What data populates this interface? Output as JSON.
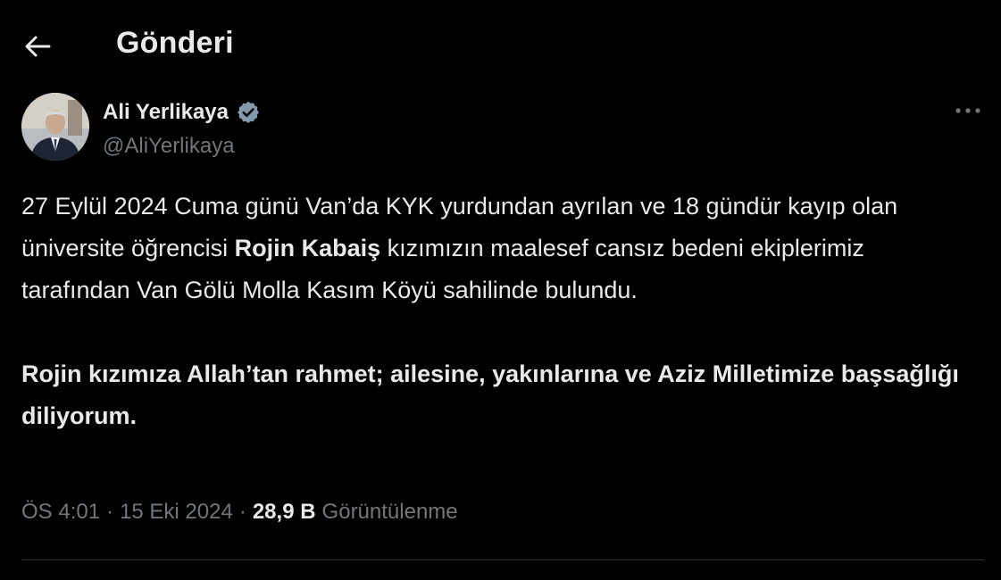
{
  "header": {
    "title": "Gönderi",
    "back_icon": "arrow-left-icon"
  },
  "author": {
    "name": "Ali Yerlikaya",
    "handle": "@AliYerlikaya",
    "verified_icon": "verified-badge-icon",
    "verified_color": "#829aab",
    "more_icon": "more-horizontal-icon"
  },
  "tweet": {
    "p1_part1": "27 Eylül 2024 Cuma günü Van’da KYK yurdundan ayrılan ve 18 gündür kayıp olan üniversite öğrencisi ",
    "p1_bold": "Rojin Kabaiş",
    "p1_part2": " kızımızın maalesef cansız bedeni ekiplerimiz tarafından Van Gölü Molla Kasım Köyü sahilinde bulundu.",
    "p2_bold": "Rojin kızımıza Allah’tan rahmet; ailesine, yakınlarına ve Aziz Milletimize başsağlığı diliyorum."
  },
  "meta": {
    "time": "ÖS 4:01",
    "separator": "·",
    "date": "15 Eki 2024",
    "views_count": "28,9 B",
    "views_label": "Görüntülenme"
  },
  "colors": {
    "background": "#000000",
    "text_primary": "#e7e9ea",
    "text_secondary": "#71767b",
    "divider": "#2f3336"
  }
}
